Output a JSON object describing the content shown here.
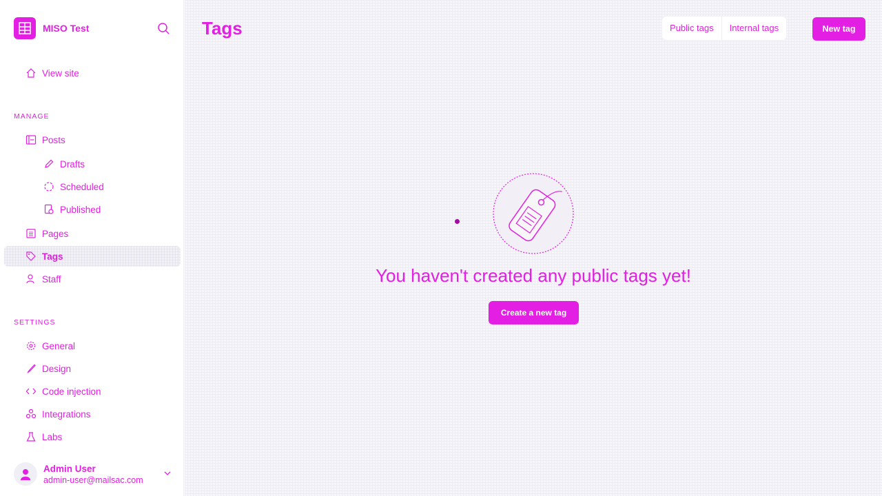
{
  "colors": {
    "accent": "#e21fe2",
    "sidebar_bg": "#ffffff",
    "main_bg": "#f7f7fa"
  },
  "brand": {
    "name": "MISO Test",
    "logo_icon": "ghost-logo-icon",
    "search_icon": "search-icon"
  },
  "sidebar": {
    "view_site": {
      "label": "View site",
      "icon": "home-icon"
    },
    "manage_heading": "MANAGE",
    "manage_items": [
      {
        "label": "Posts",
        "icon": "posts-icon"
      },
      {
        "label": "Drafts",
        "icon": "pencil-icon"
      },
      {
        "label": "Scheduled",
        "icon": "clock-icon"
      },
      {
        "label": "Published",
        "icon": "published-icon"
      },
      {
        "label": "Pages",
        "icon": "pages-icon"
      },
      {
        "label": "Tags",
        "icon": "tag-icon",
        "active": true
      },
      {
        "label": "Staff",
        "icon": "staff-icon"
      }
    ],
    "settings_heading": "SETTINGS",
    "settings_items": [
      {
        "label": "General",
        "icon": "gear-icon"
      },
      {
        "label": "Design",
        "icon": "brush-icon"
      },
      {
        "label": "Code injection",
        "icon": "code-icon"
      },
      {
        "label": "Integrations",
        "icon": "integrations-icon"
      },
      {
        "label": "Labs",
        "icon": "flask-icon"
      }
    ],
    "user": {
      "name": "Admin User",
      "email": "admin-user@mailsac.com"
    }
  },
  "main": {
    "title": "Tags",
    "tabs": [
      {
        "label": "Public tags",
        "selected": true
      },
      {
        "label": "Internal tags",
        "selected": false
      }
    ],
    "new_tag_label": "New tag",
    "empty_message": "You haven't created any public tags yet!",
    "create_label": "Create a new tag"
  }
}
